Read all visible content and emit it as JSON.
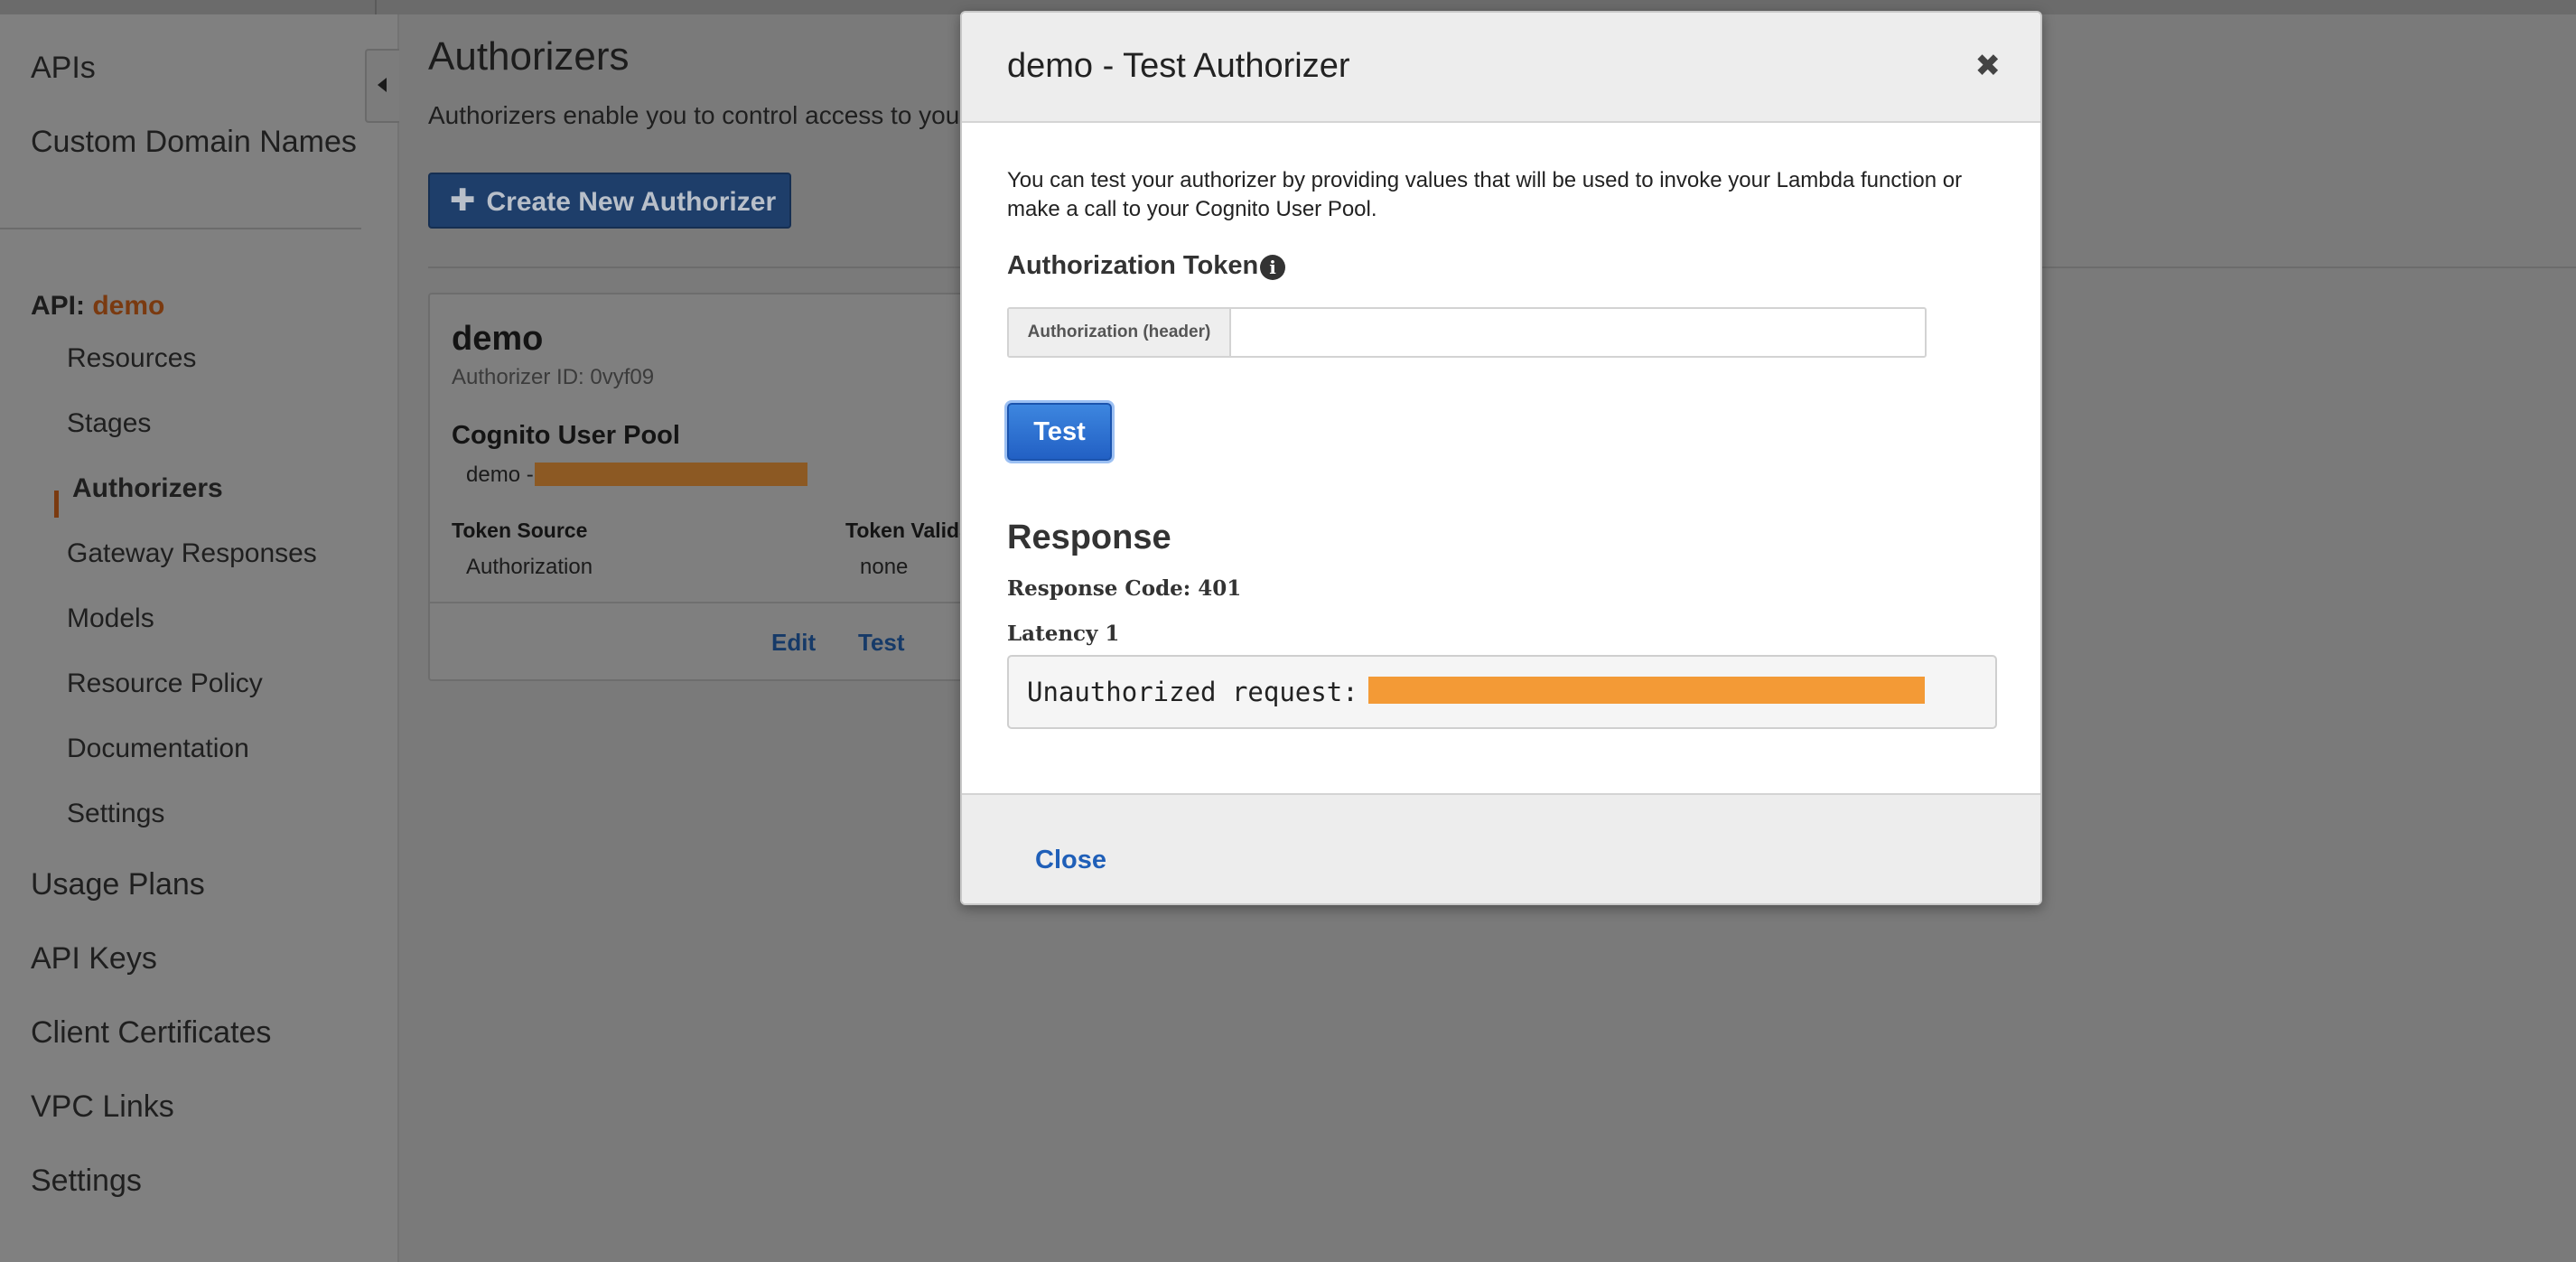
{
  "sidebar": {
    "top_items": [
      {
        "label": "APIs"
      },
      {
        "label": "Custom Domain Names"
      }
    ],
    "api_prefix": "API:",
    "api_name": "demo",
    "sub_items": [
      {
        "label": "Resources"
      },
      {
        "label": "Stages"
      },
      {
        "label": "Authorizers"
      },
      {
        "label": "Gateway Responses"
      },
      {
        "label": "Models"
      },
      {
        "label": "Resource Policy"
      },
      {
        "label": "Documentation"
      },
      {
        "label": "Settings"
      }
    ],
    "active_sub_item": "Authorizers",
    "bottom_items": [
      {
        "label": "Usage Plans"
      },
      {
        "label": "API Keys"
      },
      {
        "label": "Client Certificates"
      },
      {
        "label": "VPC Links"
      },
      {
        "label": "Settings"
      }
    ]
  },
  "main": {
    "title": "Authorizers",
    "subtitle": "Authorizers enable you to control access to you",
    "create_button": {
      "icon": "plus-icon",
      "label": "Create New Authorizer"
    },
    "card": {
      "name": "demo",
      "authorizer_id": "Authorizer ID: 0vyf09",
      "type_label": "Cognito User Pool",
      "pool_value": "demo -",
      "token_source_label": "Token Source",
      "token_source_value": "Authorization",
      "token_validation_label": "Token Valida",
      "token_validation_value": "none",
      "edit_link": "Edit",
      "test_link": "Test"
    }
  },
  "modal": {
    "title": "demo - Test Authorizer",
    "close_icon": "close-icon",
    "description": "You can test your authorizer by providing values that will be used to invoke your Lambda function or make a call to your Cognito User Pool.",
    "auth_token_title": "Authorization Token",
    "info_icon": "info-icon",
    "header_addon": "Authorization (header)",
    "header_input_value": "",
    "test_button": "Test",
    "response_title": "Response",
    "response_code": "Response Code: 401",
    "latency": "Latency 1",
    "output_text": "Unauthorized request:",
    "close_button": "Close"
  },
  "colors": {
    "brand_orange": "#f39a36",
    "primary_blue": "#2d6fd0",
    "link_blue": "#1f5fb8",
    "overlay_gray": "#7f7f7f"
  }
}
